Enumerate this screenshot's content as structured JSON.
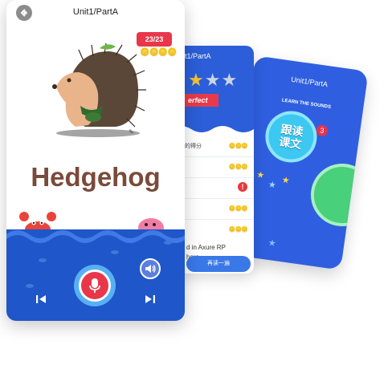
{
  "back_card": {
    "title": "Unit1/PartA",
    "subtitle": "LEARN THE SOUNDS",
    "badge_line1": "跟读",
    "badge_line2": "课文",
    "badge_number": "3"
  },
  "middle_card": {
    "title": "t1/PartA",
    "ribbon": "erfect",
    "rows": [
      {
        "text": "的得分",
        "coins": "🪙🪙🪙"
      },
      {
        "text": "",
        "coins": "🪙🪙🪙"
      },
      {
        "text": "",
        "warn": "!"
      },
      {
        "text": "",
        "coins": "🪙🪙🪙"
      },
      {
        "text": "",
        "coins": "🪙🪙🪙"
      }
    ],
    "message_line1": "d in Axure RP",
    "message_line2": "here.",
    "reread_button": "再读一遍"
  },
  "front_card": {
    "title": "Unit1/PartA",
    "score": "23/23",
    "coins": "🪙🪙🪙🪙",
    "word": "Hedgehog"
  },
  "colors": {
    "sea_blue": "#1f56c9",
    "accent_red": "#e8374a",
    "word_brown": "#7a4a3a"
  }
}
